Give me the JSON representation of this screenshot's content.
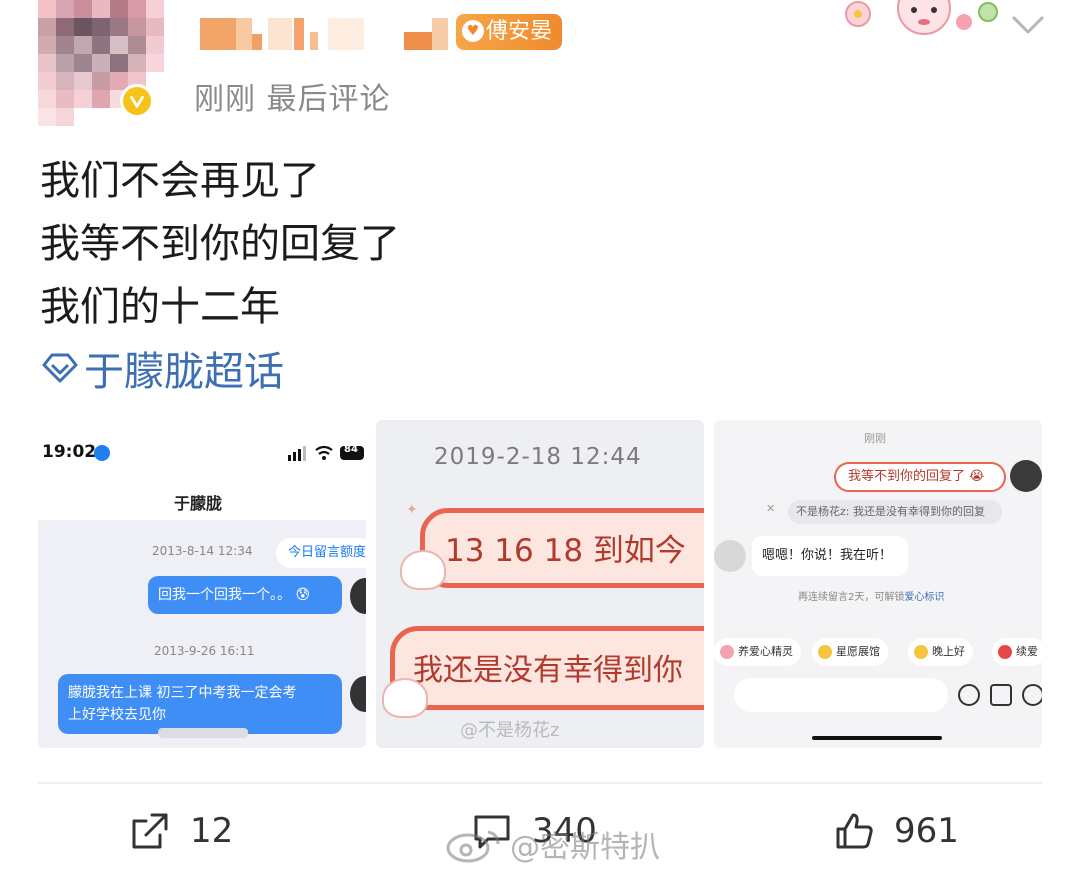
{
  "header": {
    "fan_badge": "傅安晏",
    "meta": "刚刚 最后评论"
  },
  "post": {
    "lines": [
      "我们不会再见了",
      "我等不到你的回复了",
      "我们的十二年"
    ],
    "topic": "于朦胧超话"
  },
  "images": {
    "img1": {
      "status_time": "19:02",
      "battery": "84",
      "title": "于朦胧",
      "pill": "今日留言额度",
      "ts1": "2013-8-14 12:34",
      "msg1": "回我一个回我一个。。",
      "ts2": "2013-9-26 16:11",
      "msg2_line1": "朦胧我在上课 初三了中考我一定会考",
      "msg2_line2": "上好学校去见你"
    },
    "img2": {
      "date": "2019-2-18 12:44",
      "card1": "13 16 18 到如今",
      "card2": "我还是没有幸得到你",
      "watermark": "@不是杨花z"
    },
    "img3": {
      "top": "刚刚",
      "pink_bubble": "我等不到你的回复了",
      "reply_quote": "不是杨花z: 我还是没有幸得到你的回复",
      "white_bubble": "嗯嗯！你说！我在听！",
      "note_prefix": "再连续留言2天，可解锁",
      "note_link": "爱心标识",
      "chips": [
        "养爱心精灵",
        "星愿展馆",
        "晚上好",
        "续爱"
      ]
    }
  },
  "actions": {
    "repost_count": "12",
    "comment_count": "340",
    "like_count": "961"
  },
  "watermark": "@密斯特扒",
  "colors": {
    "topic_blue": "#3d6fb3",
    "badge_orange": "#f08a2c",
    "verified_gold": "#f7c21a",
    "bubble_blue": "#3f8ef5",
    "card_red": "#e9654f"
  }
}
